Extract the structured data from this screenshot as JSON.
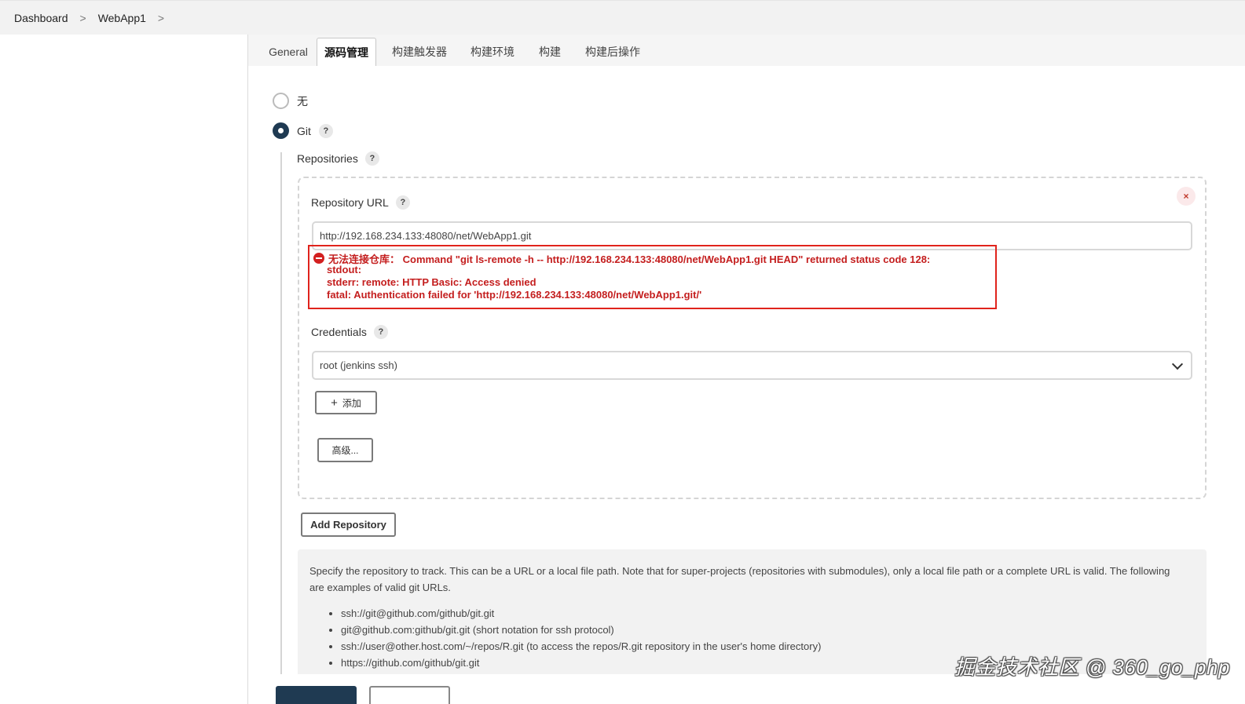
{
  "breadcrumb": {
    "items": [
      "Dashboard",
      "WebApp1"
    ],
    "separator": ">"
  },
  "tabs": [
    "General",
    "源码管理",
    "构建触发器",
    "构建环境",
    "构建",
    "构建后操作"
  ],
  "scm": {
    "options": [
      {
        "label": "无",
        "checked": false
      },
      {
        "label": "Git",
        "checked": true
      }
    ],
    "help_glyph": "?",
    "repositories_label": "Repositories",
    "repo_url_label": "Repository URL",
    "repo_url_value": "http://192.168.234.133:48080/net/WebApp1.git",
    "close_glyph": "×",
    "error": {
      "line1": "无法连接仓库：  Command \"git ls-remote -h -- http://192.168.234.133:48080/net/WebApp1.git HEAD\" returned status code 128:",
      "line2": "stdout:",
      "line3": "stderr: remote: HTTP Basic: Access denied",
      "line4": "fatal: Authentication failed for 'http://192.168.234.133:48080/net/WebApp1.git/'"
    },
    "credentials_label": "Credentials",
    "credentials_value": "root (jenkins ssh)",
    "add_button": {
      "icon": "+",
      "label": "添加"
    },
    "advanced_button": "高级...",
    "add_repository_button": "Add Repository"
  },
  "help_panel": {
    "text": "Specify the repository to track. This can be a URL or a local file path. Note that for super-projects (repositories with submodules), only a local file path or a complete URL is valid. The following are examples of valid git URLs.",
    "examples": [
      "ssh://git@github.com/github/git.git",
      "git@github.com:github/git.git (short notation for ssh protocol)",
      "ssh://user@other.host.com/~/repos/R.git (to access the repos/R.git repository in the user's home directory)",
      "https://github.com/github/git.git"
    ]
  },
  "watermark": "掘金技术社区 @ 360_go_php",
  "colors": {
    "accent": "#1f3a52",
    "error": "#e0231c"
  }
}
